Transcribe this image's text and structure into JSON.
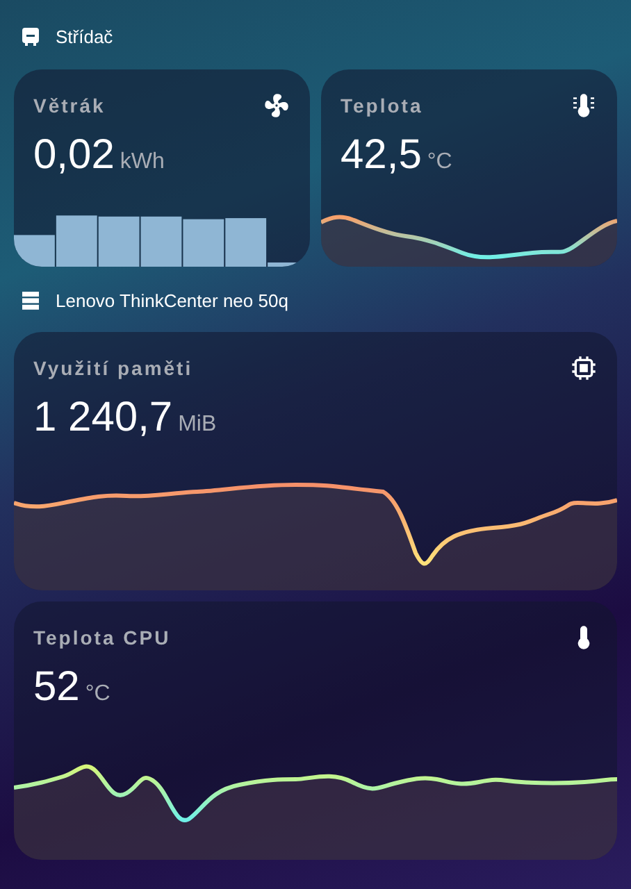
{
  "sections": [
    {
      "title": "Střídač",
      "kind": "pair",
      "cards": [
        {
          "title": "Větrák",
          "value": "0,02",
          "unit": "kWh",
          "kind": "bars"
        },
        {
          "title": "Teplota",
          "value": "42,5",
          "unit": "°C",
          "kind": "line"
        }
      ]
    },
    {
      "title": "Lenovo ThinkCenter neo 50q",
      "kind": "stack",
      "cards": [
        {
          "title": "Využití paměti",
          "value": "1 240,7",
          "unit": "MiB",
          "kind": "line"
        },
        {
          "title": "Teplota CPU",
          "value": "52",
          "unit": "°C",
          "kind": "line"
        }
      ]
    }
  ]
}
